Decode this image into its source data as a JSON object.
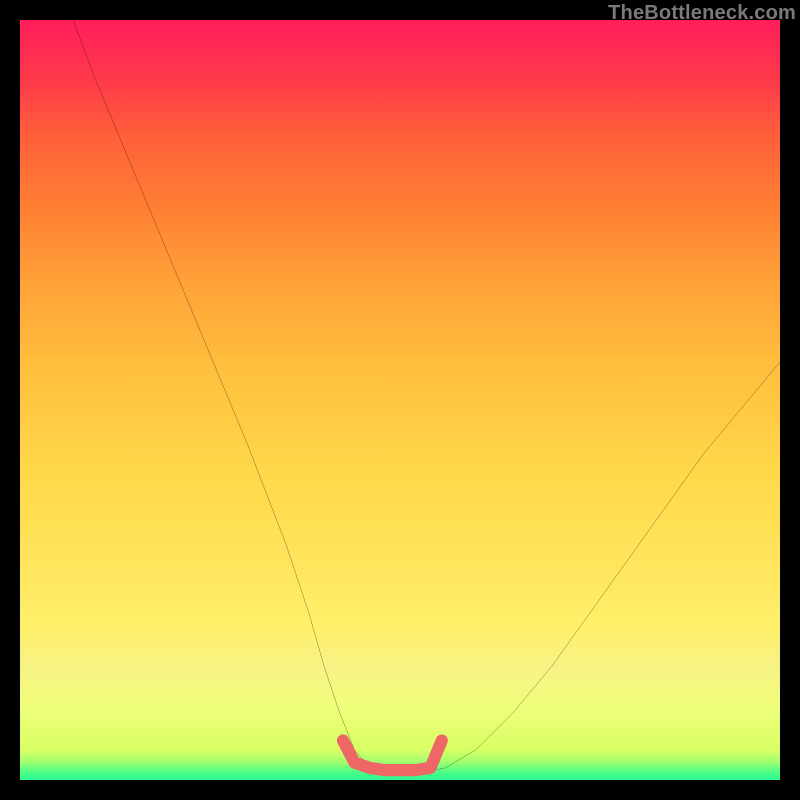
{
  "attribution": "TheBottleneck.com",
  "colors": {
    "frame": "#000000",
    "curve_stroke": "#000000",
    "highlight_stroke": "#ef6666",
    "gradient_top": "#ff1e5a",
    "gradient_bottom": "#2cfc92"
  },
  "chart_data": {
    "type": "line",
    "title": "",
    "xlabel": "",
    "ylabel": "",
    "xlim": [
      0,
      100
    ],
    "ylim": [
      0,
      100
    ],
    "grid": false,
    "series": [
      {
        "name": "bottleneck-curve",
        "x": [
          7,
          10,
          15,
          20,
          25,
          30,
          35,
          38,
          40,
          42,
          44,
          46,
          48,
          50,
          54,
          56,
          60,
          65,
          70,
          75,
          80,
          85,
          90,
          95,
          100
        ],
        "y": [
          100,
          92,
          80,
          68,
          56,
          44,
          31,
          22,
          15,
          9,
          4,
          1.6,
          1.2,
          1.2,
          1.2,
          1.6,
          4,
          9,
          15,
          22,
          29,
          36,
          43,
          49,
          55
        ]
      },
      {
        "name": "highlight-segment",
        "x": [
          42.5,
          44,
          46,
          48,
          50,
          52,
          54,
          55.5
        ],
        "y": [
          5.2,
          2.3,
          1.6,
          1.3,
          1.3,
          1.3,
          1.6,
          5.2
        ]
      }
    ]
  }
}
